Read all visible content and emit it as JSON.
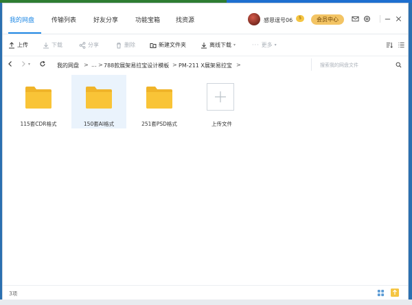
{
  "tabs": [
    {
      "label": "我的网盘"
    },
    {
      "label": "传输列表"
    },
    {
      "label": "好友分享"
    },
    {
      "label": "功能宝箱"
    },
    {
      "label": "找资源"
    }
  ],
  "user": {
    "name": "感恩逞号06",
    "vip_level": "5",
    "member_center": "会员中心"
  },
  "toolbar": {
    "upload": "上传",
    "download": "下载",
    "share": "分享",
    "delete": "删除",
    "new_folder": "新建文件夹",
    "offline_download": "离线下载",
    "more": "更多"
  },
  "breadcrumb": {
    "root": "我的网盘",
    "ellipsis": "...",
    "level1": "788款展架易拉宝设计模板",
    "level2": "PM-211 X展架易拉宝"
  },
  "search": {
    "placeholder": "搜索我的网盘文件"
  },
  "items": [
    {
      "name": "115套CDR格式",
      "type": "folder"
    },
    {
      "name": "150套AI格式",
      "type": "folder"
    },
    {
      "name": "251套PSD格式",
      "type": "folder"
    },
    {
      "name": "上传文件",
      "type": "upload"
    }
  ],
  "status": {
    "count": "3项"
  },
  "colors": {
    "accent": "#1e88e5",
    "folder": "#f9c437",
    "member": "#f3c464"
  }
}
